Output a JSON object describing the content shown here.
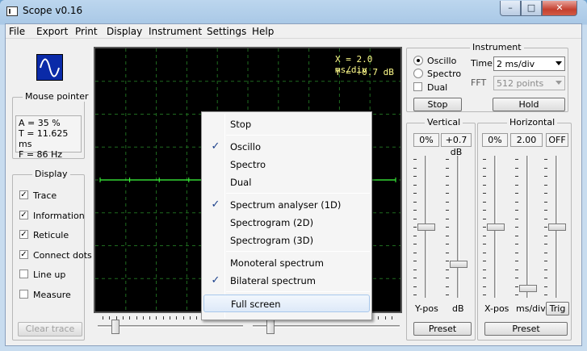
{
  "window": {
    "title": "Scope v0.16",
    "controls": {
      "minimize": "–",
      "maximize": "□",
      "close": "✕"
    }
  },
  "menu": [
    "File",
    "Export",
    "Print",
    "Display",
    "Instrument",
    "Settings",
    "Help"
  ],
  "mouse_pointer": {
    "title": "Mouse pointer",
    "a": "A = 35 %",
    "t": "T = 11.625 ms",
    "f": "F = 86 Hz"
  },
  "display": {
    "title": "Display",
    "items": [
      {
        "label": "Trace",
        "checked": true
      },
      {
        "label": "Information",
        "checked": true
      },
      {
        "label": "Reticule",
        "checked": true
      },
      {
        "label": "Connect dots",
        "checked": true
      },
      {
        "label": "Line up",
        "checked": false
      },
      {
        "label": "Measure",
        "checked": false
      }
    ],
    "clear_trace": "Clear trace"
  },
  "scope": {
    "x_info": "X = 2.0 ms/div",
    "y_info": "Y = +0.7 dB",
    "trace_color": "#3cff3c",
    "grid_color": "#1f6b1f"
  },
  "context_menu": [
    {
      "label": "Stop",
      "checked": false
    },
    {
      "sep": true
    },
    {
      "label": "Oscillo",
      "checked": true
    },
    {
      "label": "Spectro",
      "checked": false
    },
    {
      "label": "Dual",
      "checked": false
    },
    {
      "sep": true
    },
    {
      "label": "Spectrum analyser (1D)",
      "checked": true
    },
    {
      "label": "Spectrogram (2D)",
      "checked": false
    },
    {
      "label": "Spectrogram (3D)",
      "checked": false
    },
    {
      "sep": true
    },
    {
      "label": "Monoteral spectrum",
      "checked": false
    },
    {
      "label": "Bilateral spectrum",
      "checked": true
    },
    {
      "sep": true
    },
    {
      "label": "Full screen",
      "checked": false,
      "hover": true
    }
  ],
  "instrument": {
    "title": "Instrument",
    "modes": [
      {
        "label": "Oscillo",
        "selected": true
      },
      {
        "label": "Spectro",
        "selected": false
      }
    ],
    "dual": {
      "label": "Dual",
      "checked": false
    },
    "time_label": "Time",
    "time_value": "2 ms/div",
    "fft_label": "FFT",
    "fft_value": "512 points",
    "stop": "Stop",
    "hold": "Hold"
  },
  "vertical": {
    "title": "Vertical",
    "ypos_value": "0%",
    "db_value": "+0.7 dB",
    "ypos_label": "Y-pos",
    "db_label": "dB",
    "preset": "Preset",
    "ypos_level": 0.5,
    "db_level": 0.78
  },
  "horizontal": {
    "title": "Horizontal",
    "xpos_value": "0%",
    "msdiv_value": "2.00",
    "trig_value": "OFF",
    "xpos_label": "X-pos",
    "msdiv_label": "ms/div",
    "trig": "Trig",
    "preset": "Preset",
    "xpos_level": 0.5,
    "msdiv_level": 0.96,
    "trig_level": 0.5
  },
  "bottom_sliders": {
    "left_level": 0.05,
    "right_level": 0.05
  }
}
